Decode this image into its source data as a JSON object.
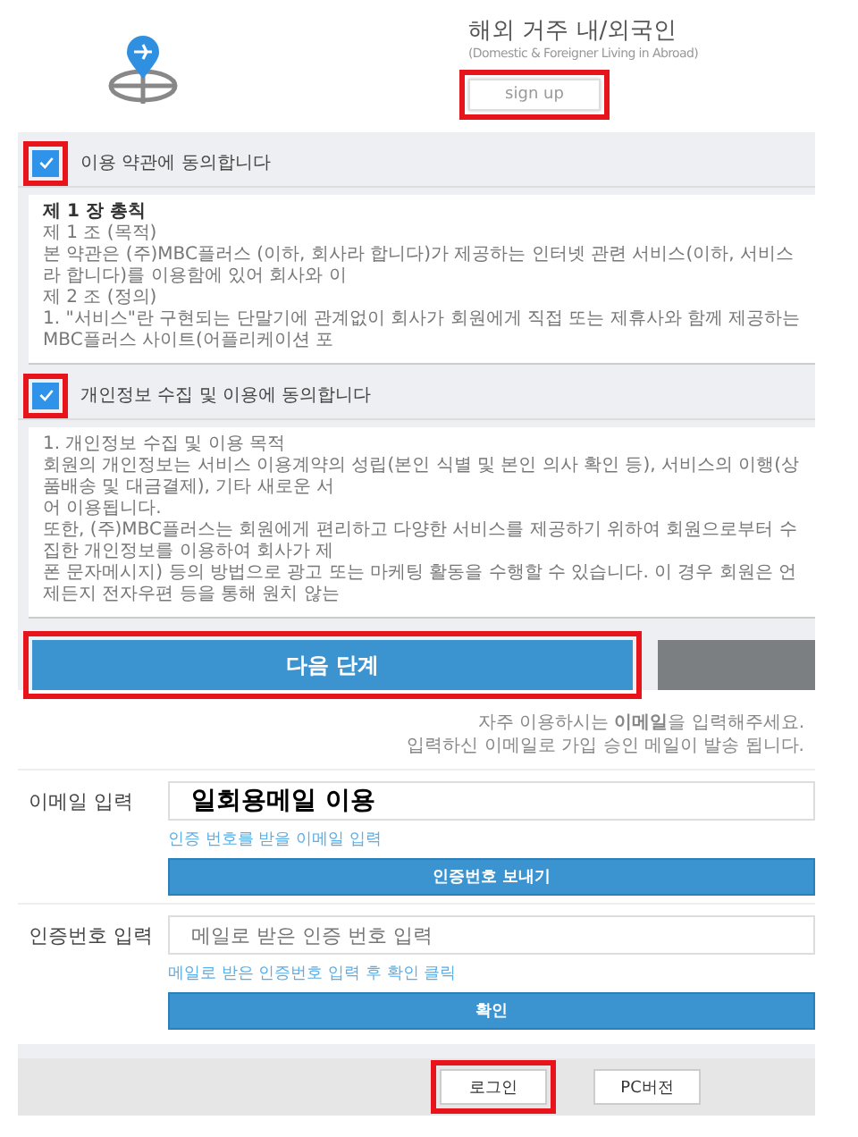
{
  "header": {
    "title": "해외 거주 내/외국인",
    "subtitle": "(Domestic & Foreigner Living in Abroad)",
    "signup_button": {
      "label": "sign up",
      "highlighted": true
    }
  },
  "agreements": [
    {
      "label": "이용 약관에 동의합니다",
      "checked": true,
      "highlighted": true,
      "lines": [
        {
          "text": "제 1 장 총칙",
          "bold": true
        },
        {
          "text": "제 1 조 (목적)",
          "bold": false
        },
        {
          "text": "본 약관은 (주)MBC플러스 (이하, 회사라 합니다)가 제공하는 인터넷 관련 서비스(이하, 서비스라 합니다)를 이용함에 있어 회사와 이",
          "bold": false
        },
        {
          "text": "제 2 조 (정의)",
          "bold": false
        },
        {
          "text": "1. \"서비스\"란 구현되는 단말기에 관계없이 회사가 회원에게 직접 또는 제휴사와 함께 제공하는 MBC플러스 사이트(어플리케이션 포",
          "bold": false
        }
      ]
    },
    {
      "label": "개인정보 수집 및 이용에 동의합니다",
      "checked": true,
      "highlighted": true,
      "lines": [
        {
          "text": "1. 개인정보 수집 및 이용 목적",
          "bold": false
        },
        {
          "text": "회원의 개인정보는 서비스 이용계약의 성립(본인 식별 및 본인 의사 확인 등), 서비스의 이행(상품배송 및 대금결제), 기타 새로운 서",
          "bold": false
        },
        {
          "text": "어 이용됩니다.",
          "bold": false
        },
        {
          "text": "또한, (주)MBC플러스는 회원에게 편리하고 다양한 서비스를 제공하기 위하여 회원으로부터 수집한 개인정보를 이용하여 회사가 제",
          "bold": false
        },
        {
          "text": "폰 문자메시지) 등의 방법으로 광고 또는 마케팅 활동을 수행할 수 있습니다. 이 경우 회원은 언제든지 전자우편 등을 통해 원치 않는",
          "bold": false
        }
      ]
    }
  ],
  "next_button": {
    "label": "다음 단계",
    "highlighted": true
  },
  "intro": {
    "line1": "자주 이용하시는 **이메일**을 입력해주세요.",
    "line2": "입력하신 이메일로 가입 승인 메일이 발송 됩니다."
  },
  "email": {
    "label": "이메일 입력",
    "value": "일회용메일 이용",
    "hint": "인증 번호를 받을 이메일 입력",
    "button": "인증번호 보내기"
  },
  "code": {
    "label": "인증번호 입력",
    "placeholder": "메일로 받은 인증 번호 입력",
    "hint": "메일로 받은 인증번호 입력 후 확인 클릭",
    "button": "확인"
  },
  "footer": {
    "buttons": [
      {
        "label": "로그인",
        "highlighted": true
      },
      {
        "label": "PC버전",
        "highlighted": false
      }
    ]
  }
}
